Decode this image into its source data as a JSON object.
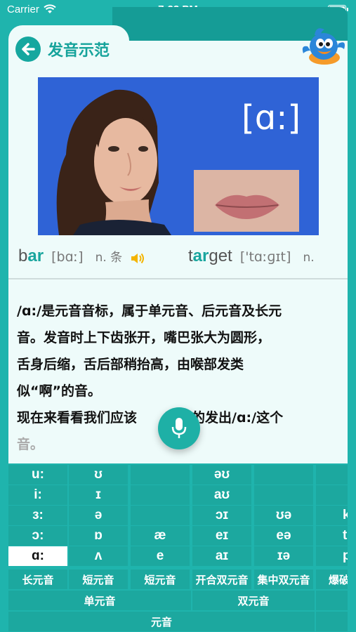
{
  "status": {
    "carrier": "Carrier",
    "time": "7:23 PM"
  },
  "header": {
    "title": "发音示范"
  },
  "video": {
    "ipa": "[ɑ:]"
  },
  "examples": [
    {
      "pre": "b",
      "hi": "ar",
      "post": "",
      "phonetic": "[bɑː]",
      "pos": "n. 条"
    },
    {
      "pre": "t",
      "hi": "ar",
      "post": "get",
      "phonetic": "['tɑːɡɪt]",
      "pos": "n."
    }
  ],
  "description": {
    "line1": "/ɑ:/是元音音标，属于单元音、后元音及长元",
    "line2": "音。发音时上下齿张开，嘴巴张大为圆形，",
    "line3": "舌身后缩，舌后部稍抬高，由喉部发类",
    "line4": "似“啊”的音。",
    "line5a": "现在来看看我们应该",
    "line5b": "正确的发出/ɑ:/这个",
    "line6": "音。"
  },
  "grid": {
    "rows": [
      [
        "u:",
        "ʊ",
        "",
        "əʊ",
        "",
        ""
      ],
      [
        "i:",
        "ɪ",
        "",
        "aʊ",
        "",
        ""
      ],
      [
        "ɜ:",
        "ə",
        "",
        "ɔɪ",
        "ʊə",
        "k"
      ],
      [
        "ɔ:",
        "ɒ",
        "æ",
        "eɪ",
        "eə",
        "t"
      ],
      [
        "ɑ:",
        "ʌ",
        "e",
        "aɪ",
        "ɪə",
        "p"
      ]
    ],
    "selected": "ɑ:",
    "categories": [
      "长元音",
      "短元音",
      "短元音",
      "开合双元音",
      "集中双元音",
      "爆破"
    ],
    "groups": [
      "单元音",
      "双元音"
    ],
    "top_group": "元音"
  },
  "colors": {
    "teal": "#1fb4ad",
    "dark_teal": "#159c96",
    "panel": "#eefbfa",
    "video_bg": "#2f63d6"
  }
}
